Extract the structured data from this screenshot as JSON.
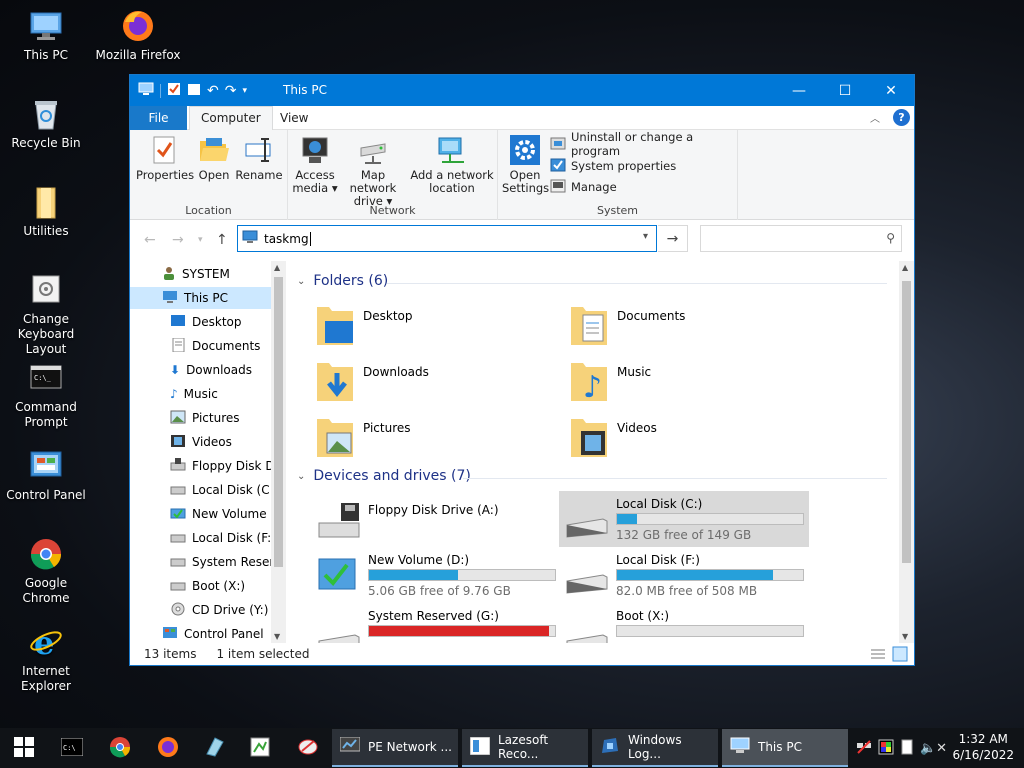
{
  "desktop": {
    "icons": [
      {
        "label": "This PC"
      },
      {
        "label": "Mozilla Firefox"
      },
      {
        "label": "Recycle Bin"
      },
      {
        "label": "Utilities"
      },
      {
        "label": "Change Keyboard Layout"
      },
      {
        "label": "Command Prompt"
      },
      {
        "label": "Control Panel"
      },
      {
        "label": "Google Chrome"
      },
      {
        "label": "Internet Explorer"
      }
    ]
  },
  "window": {
    "title": "This PC",
    "tabs": {
      "file": "File",
      "computer": "Computer",
      "view": "View"
    },
    "ribbon": {
      "location": {
        "label": "Location",
        "properties": "Properties",
        "open": "Open",
        "rename": "Rename"
      },
      "network": {
        "label": "Network",
        "access_media": "Access media",
        "map_drive": "Map network drive",
        "add_location": "Add a network location"
      },
      "system": {
        "label": "System",
        "open_settings": "Open Settings",
        "uninstall": "Uninstall or change a program",
        "system_properties": "System properties",
        "manage": "Manage"
      }
    },
    "address": {
      "value": "taskmg"
    },
    "nav_pane": {
      "items": [
        {
          "label": "SYSTEM"
        },
        {
          "label": "This PC"
        },
        {
          "label": "Desktop"
        },
        {
          "label": "Documents"
        },
        {
          "label": "Downloads"
        },
        {
          "label": "Music"
        },
        {
          "label": "Pictures"
        },
        {
          "label": "Videos"
        },
        {
          "label": "Floppy Disk Dri"
        },
        {
          "label": "Local Disk (C:)"
        },
        {
          "label": "New Volume (D"
        },
        {
          "label": "Local Disk (F:)"
        },
        {
          "label": "System Reserve"
        },
        {
          "label": "Boot (X:)"
        },
        {
          "label": "CD Drive (Y:) H"
        },
        {
          "label": "Control Panel"
        }
      ]
    },
    "folders": {
      "heading": "Folders (6)",
      "items": [
        {
          "label": "Desktop"
        },
        {
          "label": "Documents"
        },
        {
          "label": "Downloads"
        },
        {
          "label": "Music"
        },
        {
          "label": "Pictures"
        },
        {
          "label": "Videos"
        }
      ]
    },
    "drives": {
      "heading": "Devices and drives (7)",
      "items": [
        {
          "label": "Floppy Disk Drive (A:)",
          "free": "",
          "used_fraction": null
        },
        {
          "label": "Local Disk (C:)",
          "free": "132 GB free of 149 GB",
          "used_fraction": 0.11
        },
        {
          "label": "New Volume (D:)",
          "free": "5.06 GB free of 9.76 GB",
          "used_fraction": 0.48
        },
        {
          "label": "Local Disk (F:)",
          "free": "82.0 MB free of 508 MB",
          "used_fraction": 0.84
        },
        {
          "label": "System Reserved (G:)",
          "free": "",
          "used_fraction": 0.97
        },
        {
          "label": "Boot (X:)",
          "free": "",
          "used_fraction": 0.0
        }
      ]
    },
    "status": {
      "count": "13 items",
      "selected": "1 item selected"
    }
  },
  "taskbar": {
    "tasks": [
      {
        "label": "PE Network ..."
      },
      {
        "label": "Lazesoft Reco..."
      },
      {
        "label": "Windows Log..."
      },
      {
        "label": "This PC"
      }
    ],
    "clock": {
      "time": "1:32 AM",
      "date": "6/16/2022"
    }
  }
}
